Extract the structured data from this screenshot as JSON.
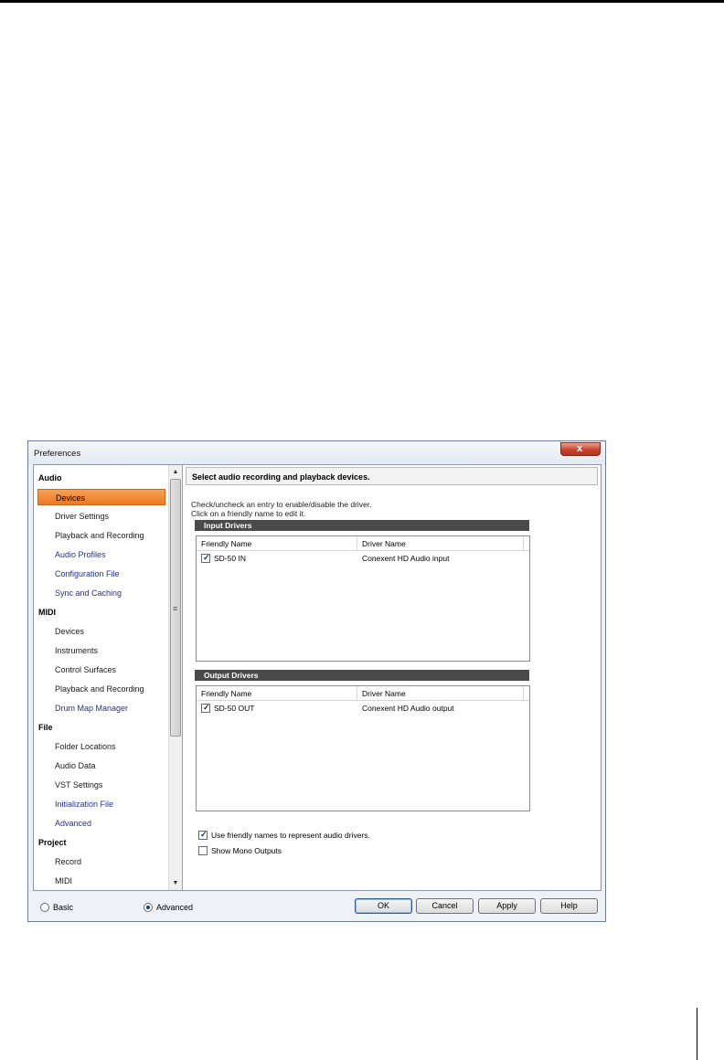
{
  "window": {
    "title": "Preferences",
    "close_glyph": "x"
  },
  "nav": {
    "items": [
      {
        "label": "Audio",
        "type": "category"
      },
      {
        "label": "Devices",
        "type": "selected"
      },
      {
        "label": "Driver Settings",
        "type": "item"
      },
      {
        "label": "Playback and Recording",
        "type": "item"
      },
      {
        "label": "Audio Profiles",
        "type": "item-blue"
      },
      {
        "label": "Configuration File",
        "type": "item-blue"
      },
      {
        "label": "Sync and Caching",
        "type": "item-blue"
      },
      {
        "label": "MIDI",
        "type": "category"
      },
      {
        "label": "Devices",
        "type": "item"
      },
      {
        "label": "Instruments",
        "type": "item"
      },
      {
        "label": "Control Surfaces",
        "type": "item"
      },
      {
        "label": "Playback and Recording",
        "type": "item"
      },
      {
        "label": "Drum Map Manager",
        "type": "item-blue"
      },
      {
        "label": "File",
        "type": "category"
      },
      {
        "label": "Folder Locations",
        "type": "item"
      },
      {
        "label": "Audio Data",
        "type": "item"
      },
      {
        "label": "VST Settings",
        "type": "item"
      },
      {
        "label": "Initialization File",
        "type": "item-blue"
      },
      {
        "label": "Advanced",
        "type": "item-blue"
      },
      {
        "label": "Project",
        "type": "category"
      },
      {
        "label": "Record",
        "type": "item"
      },
      {
        "label": "MIDI",
        "type": "item"
      }
    ]
  },
  "pane": {
    "header": "Select audio recording and playback devices.",
    "instruction_1": "Check/uncheck an entry to enable/disable the driver.",
    "instruction_2": "Click on a friendly name to edit it.",
    "input_group": {
      "title": "Input Drivers",
      "col_friendly": "Friendly Name",
      "col_driver": "Driver Name",
      "rows": [
        {
          "friendly": "SD-50 IN",
          "driver": "Conexent HD Audio input",
          "checked": true
        }
      ]
    },
    "output_group": {
      "title": "Output Drivers",
      "col_friendly": "Friendly Name",
      "col_driver": "Driver Name",
      "rows": [
        {
          "friendly": "SD-50 OUT",
          "driver": "Conexent HD Audio output",
          "checked": true
        }
      ]
    },
    "option_friendly": {
      "label": "Use friendly names to represent audio drivers.",
      "checked": true
    },
    "option_mono": {
      "label": "Show Mono Outputs",
      "checked": false
    }
  },
  "footer": {
    "mode_basic": "Basic",
    "mode_advanced": "Advanced",
    "mode_selected": "Advanced",
    "ok": "OK",
    "cancel": "Cancel",
    "apply": "Apply",
    "help": "Help"
  },
  "colors": {
    "selection_orange": "#ee7a1e",
    "group_header": "#4a4a4a",
    "link_blue": "#26328a",
    "close_red": "#c9462e"
  }
}
